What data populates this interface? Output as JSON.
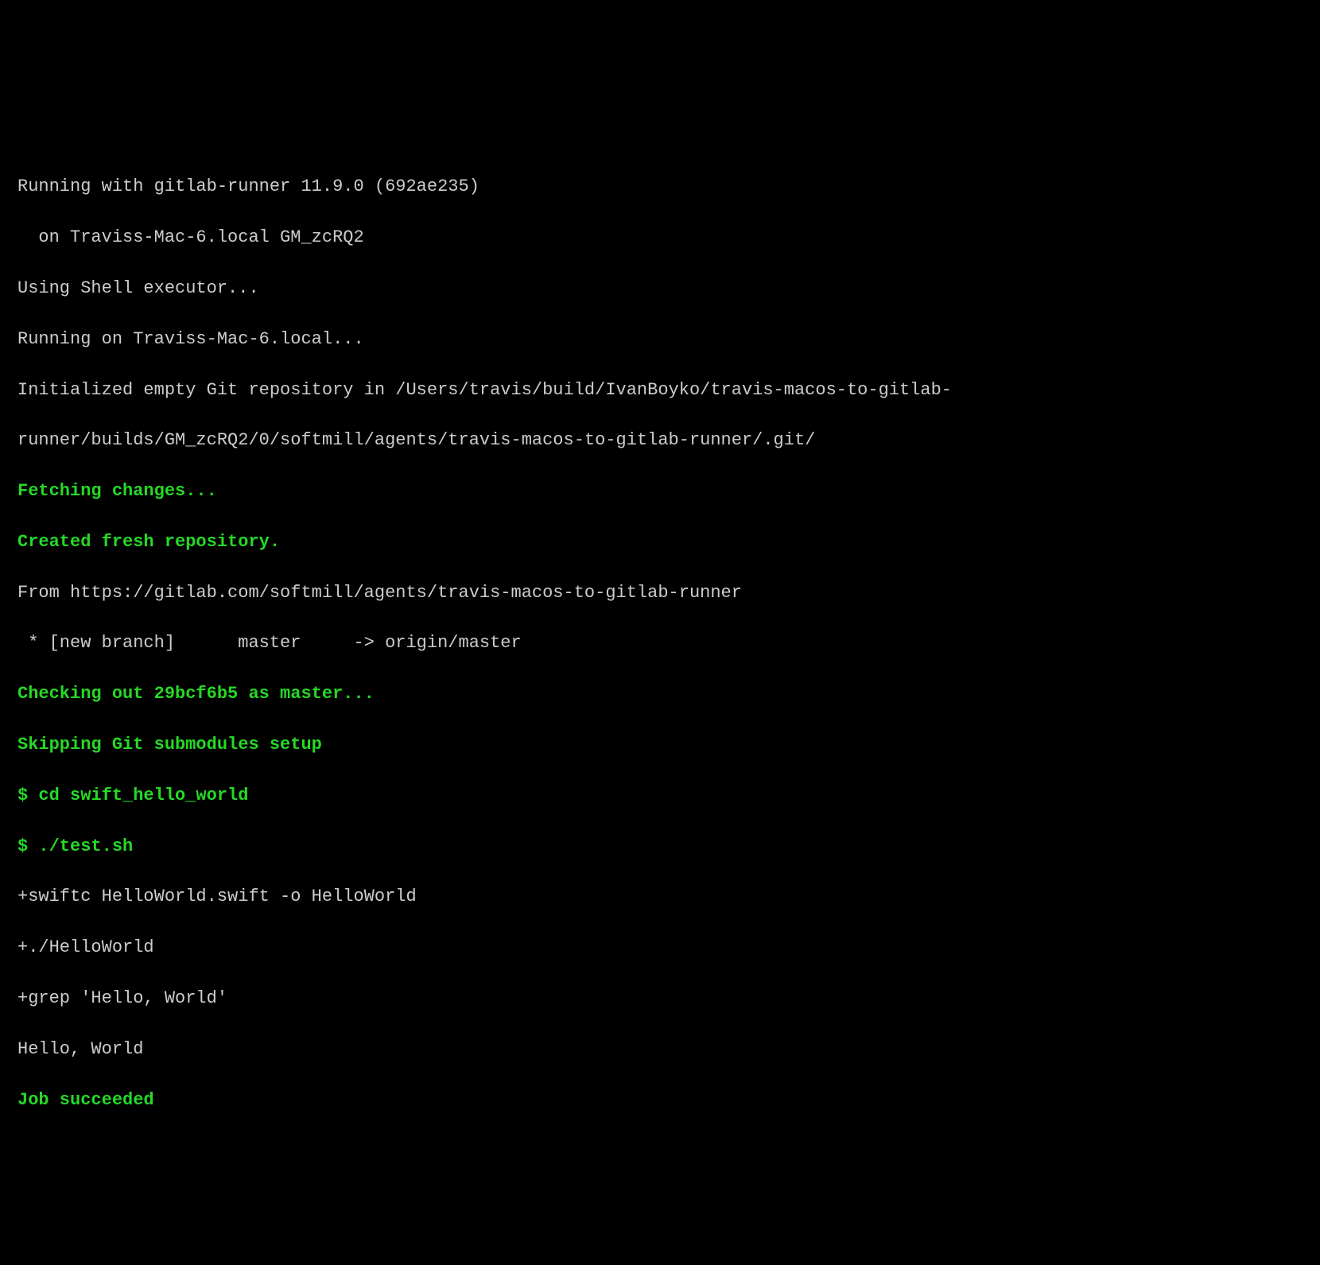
{
  "terminal": {
    "lines": [
      {
        "text": "Running with gitlab-runner 11.9.0 (692ae235)",
        "style": "white"
      },
      {
        "text": "  on Traviss-Mac-6.local GM_zcRQ2",
        "style": "white"
      },
      {
        "text": "Using Shell executor...",
        "style": "white"
      },
      {
        "text": "Running on Traviss-Mac-6.local...",
        "style": "white"
      },
      {
        "text": "Initialized empty Git repository in /Users/travis/build/IvanBoyko/travis-macos-to-gitlab-",
        "style": "white"
      },
      {
        "text": "runner/builds/GM_zcRQ2/0/softmill/agents/travis-macos-to-gitlab-runner/.git/",
        "style": "white"
      },
      {
        "text": "Fetching changes...",
        "style": "green"
      },
      {
        "text": "Created fresh repository.",
        "style": "green"
      },
      {
        "text": "From https://gitlab.com/softmill/agents/travis-macos-to-gitlab-runner",
        "style": "white"
      },
      {
        "text": " * [new branch]      master     -> origin/master",
        "style": "white"
      },
      {
        "text": "Checking out 29bcf6b5 as master...",
        "style": "green"
      },
      {
        "text": "Skipping Git submodules setup",
        "style": "green"
      },
      {
        "text": "$ cd swift_hello_world",
        "style": "green"
      },
      {
        "text": "$ ./test.sh",
        "style": "green"
      },
      {
        "text": "+swiftc HelloWorld.swift -o HelloWorld",
        "style": "white"
      },
      {
        "text": "+./HelloWorld",
        "style": "white"
      },
      {
        "text": "+grep 'Hello, World'",
        "style": "white"
      },
      {
        "text": "Hello, World",
        "style": "white"
      },
      {
        "text": "Job succeeded",
        "style": "green"
      }
    ]
  }
}
